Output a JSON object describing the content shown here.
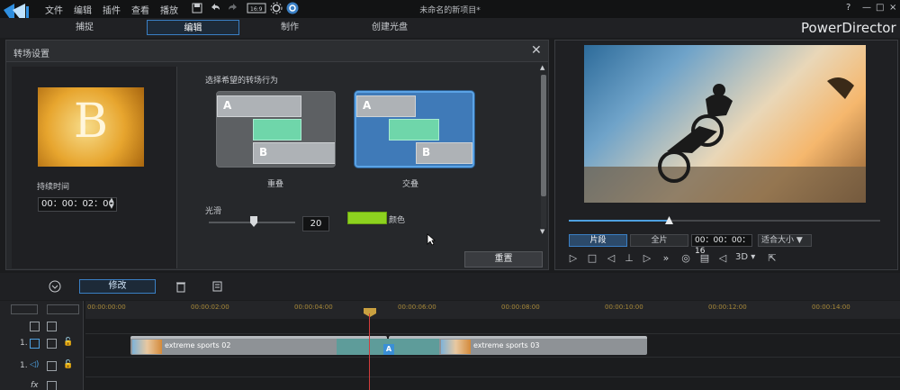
{
  "window": {
    "title": "未命名的新项目*",
    "brand": "PowerDirector",
    "menu": [
      "文件",
      "编辑",
      "插件",
      "查看",
      "播放"
    ],
    "controls": [
      "?",
      "—",
      "□",
      "×"
    ]
  },
  "modes": [
    "捕捉",
    "编辑",
    "制作",
    "创建光盘"
  ],
  "transition_panel": {
    "title": "转场设置",
    "thumb_letter": "B",
    "duration_label": "持续时间",
    "duration_value": "00：00：02：00",
    "prompt": "选择希望的转场行为",
    "options": [
      {
        "label": "重叠",
        "a": "A",
        "b": "B",
        "selected": false
      },
      {
        "label": "交叠",
        "a": "A",
        "b": "B",
        "selected": true
      }
    ],
    "smooth_label": "光滑",
    "smooth_value": "20",
    "color_label": "颜色",
    "color_value": "#8dd21f",
    "reset_label": "重置"
  },
  "preview": {
    "segment_label": "片段",
    "full_label": "全片",
    "timecode": "00：00：00：16",
    "fit_label": "适合大小",
    "threed_label": "3D",
    "progress": 0.32
  },
  "timeline": {
    "modify_label": "修改",
    "ticks": [
      "00:00:00:00",
      "00:00:02:00",
      "00:00:04:00",
      "00:00:06:00",
      "00:00:08:00",
      "00:00:10:00",
      "00:00:12:00",
      "00:00:14:00"
    ],
    "track_labels": [
      "1.",
      "1.",
      "fx"
    ],
    "clips": [
      {
        "name": "extreme sports 02"
      },
      {
        "name": "extreme sports 03"
      }
    ],
    "transition_mark": "A"
  },
  "colors": {
    "accent": "#3a7fc4",
    "selected_option": "#3f7ab8"
  }
}
